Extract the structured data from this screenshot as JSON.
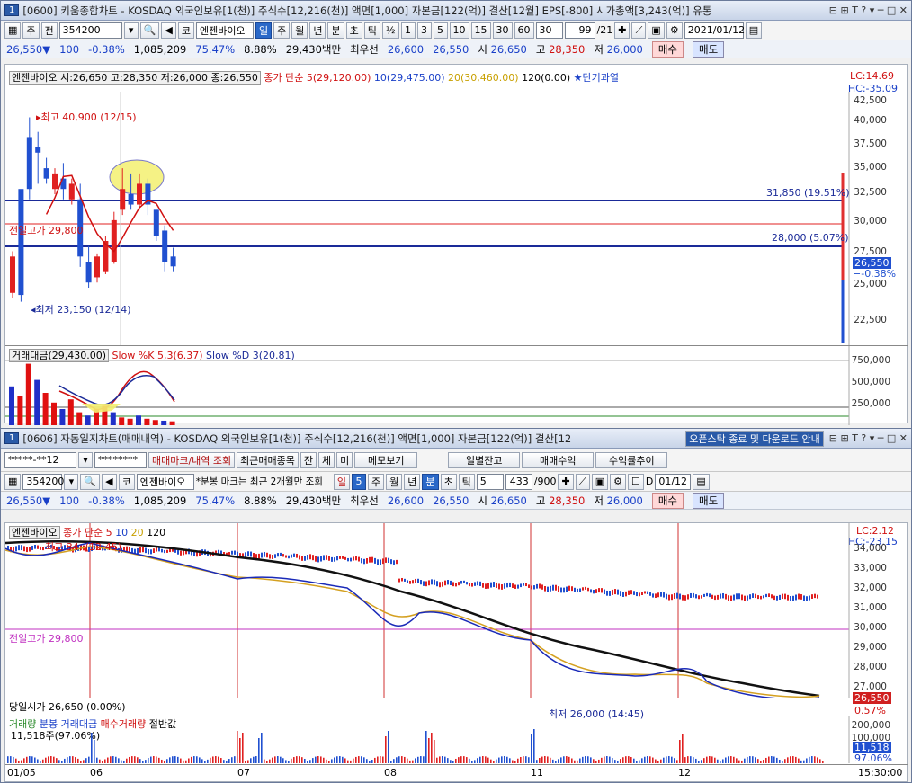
{
  "win1": {
    "title_num": "1",
    "title": "[0600] 키움종합차트 - KOSDAQ 외국인보유[1(천)] 주식수[12,216(천)] 액면[1,000] 자본금[122(억)] 결산[12월] EPS[-800] 시가총액[3,243(억)] 유통",
    "title_controls": "⊟ ⊞ T ? ▾ ─ □ ✕",
    "toolbar": {
      "mode1": "주",
      "mode2": "전",
      "code": "354200",
      "market": "코",
      "name": "엔젠바이오",
      "periods": [
        "일",
        "주",
        "월",
        "년",
        "분",
        "초",
        "틱"
      ],
      "active_period": "일",
      "intervals": [
        "½",
        "1",
        "3",
        "5",
        "10",
        "15",
        "30",
        "60"
      ],
      "interval_sel": "30",
      "count": "99",
      "count_total": "/21",
      "date": "2021/01/12"
    },
    "quote": {
      "price": "26,550",
      "arrow": "▼",
      "change": "100",
      "change_pct": "-0.38%",
      "volume": "1,085,209",
      "ratio": "75.47%",
      "turnover": "8.88%",
      "amount": "29,430백만",
      "best_label": "최우선",
      "best_sell": "26,600",
      "best_buy": "26,550",
      "open_label": "시",
      "open": "26,650",
      "high_label": "고",
      "high": "28,350",
      "low_label": "저",
      "low": "26,000",
      "buy": "매수",
      "sell": "매도"
    },
    "legend": {
      "info": "엔젠바이오 시:26,650 고:28,350 저:26,000 종:26,550",
      "ma_label": "종가 단순",
      "ma5": "5(29,120.00)",
      "ma10": "10(29,475.00)",
      "ma20": "20(30,460.00)",
      "ma120": "120(0.00)",
      "signal": "★단기과열"
    },
    "lc": "LC:14.69",
    "hc": "HC:-35.09",
    "high_note": "최고 40,900 (12/15)",
    "low_note": "최저 23,150 (12/14)",
    "prev_high": "전일고가 29,800",
    "line1": "31,850 (19.51%)",
    "line2": "28,000 (5.07%)",
    "cur_price": "26,550",
    "cur_pct": "-0.38%",
    "yticks": [
      "42,500",
      "40,000",
      "37,500",
      "35,000",
      "32,500",
      "30,000",
      "27,500",
      "25,000",
      "22,500"
    ],
    "sub_legend": {
      "amount": "거래대금(29,430.00)",
      "k": "Slow %K 5,3(6.37)",
      "d": "Slow %D 3(20.81)"
    },
    "sub_yticks": [
      "750,000",
      "500,000",
      "250,000"
    ],
    "chart_data": {
      "type": "candlestick",
      "open": [
        24000,
        34000,
        39000,
        38000,
        36000,
        34000,
        35000,
        33000,
        33000,
        27000,
        25500,
        26000,
        27000,
        32000,
        33500,
        32500,
        34500,
        32000,
        30000,
        27500
      ],
      "close": [
        27500,
        23800,
        34000,
        37500,
        35000,
        35500,
        34000,
        34500,
        27500,
        25000,
        27500,
        29000,
        31000,
        34000,
        32500,
        34500,
        32500,
        29500,
        27000,
        26550
      ],
      "high": [
        28000,
        32000,
        40900,
        39500,
        37000,
        36000,
        36500,
        35000,
        34500,
        28500,
        27800,
        29500,
        31800,
        36000,
        35500,
        35500,
        35000,
        32000,
        30500,
        28350
      ],
      "low": [
        23500,
        23150,
        33000,
        34500,
        34500,
        33500,
        33000,
        32500,
        26500,
        24500,
        25000,
        25800,
        26800,
        31500,
        32000,
        32000,
        31500,
        29000,
        26000,
        26000
      ]
    }
  },
  "win2": {
    "title_num": "1",
    "title": "[0606] 자동일지차트(매매내역) - KOSDAQ 외국인보유[1(천)] 주식수[12,216(천)] 액면[1,000] 자본금[122(억)] 결산[12",
    "title_notice": "오픈스탁 종료 및 다운로드 안내",
    "title_controls": "⊟ ⊞ T ? ▾ ─ □ ✕",
    "toolbar1": {
      "account": "*****-**12",
      "password": "********",
      "btn1": "매매마크/내역 조회",
      "btn2": "최근매매종목",
      "j": "잔",
      "c": "체",
      "m": "미",
      "memo": "메모보기",
      "daily": "일별잔고",
      "profit": "매매수익",
      "rate": "수익률추이"
    },
    "toolbar2": {
      "code": "354200",
      "market": "코",
      "name": "엔젠바이오",
      "note": "*분봉 마크는 최근 2개월만 조회",
      "periods": [
        "일",
        "5",
        "주",
        "월",
        "년",
        "분",
        "초",
        "틱"
      ],
      "interval": "5",
      "count": "433",
      "count_total": "/900",
      "d_label": "D",
      "date": "01/12"
    },
    "quote": {
      "price": "26,550",
      "arrow": "▼",
      "change": "100",
      "change_pct": "-0.38%",
      "volume": "1,085,209",
      "ratio": "75.47%",
      "turnover": "8.88%",
      "amount": "29,430백만",
      "best_label": "최우선",
      "best_sell": "26,600",
      "best_buy": "26,550",
      "open_label": "시",
      "open": "26,650",
      "high_label": "고",
      "high": "28,350",
      "low_label": "저",
      "low": "26,000",
      "buy": "매수",
      "sell": "매도"
    },
    "legend": {
      "name": "엔젠바이오",
      "ma": "종가 단순 5",
      "ma10": "10",
      "ma20": "20",
      "ma120": "120"
    },
    "high_note": "최고 34,",
    "high_time": "(12:45)",
    "low_note": "최저 26,000 (14:45)",
    "prev_high": "전일고가 29,800",
    "open_note": "당일시가 26,650 (0.00%)",
    "lc": "LC:2.12",
    "hc": "HC:-23.15",
    "cur_price": "26,550",
    "cur_pct": "0.57%",
    "yticks": [
      "34,000",
      "33,000",
      "32,000",
      "31,000",
      "30,000",
      "29,000",
      "28,000",
      "27,000"
    ],
    "sub_legend": {
      "vol": "거래량",
      "min": "분봉 거래대금",
      "buy": "매수거래량",
      "half": "절반값"
    },
    "sub_info": "11,518주(97.06%)",
    "sub_yticks": [
      "200,000",
      "100,000"
    ],
    "sub_cur": "11,518",
    "sub_pct": "97.06%",
    "xlabels": [
      "01/05",
      "06",
      "07",
      "08",
      "11",
      "12"
    ],
    "time": "15:30:00"
  }
}
